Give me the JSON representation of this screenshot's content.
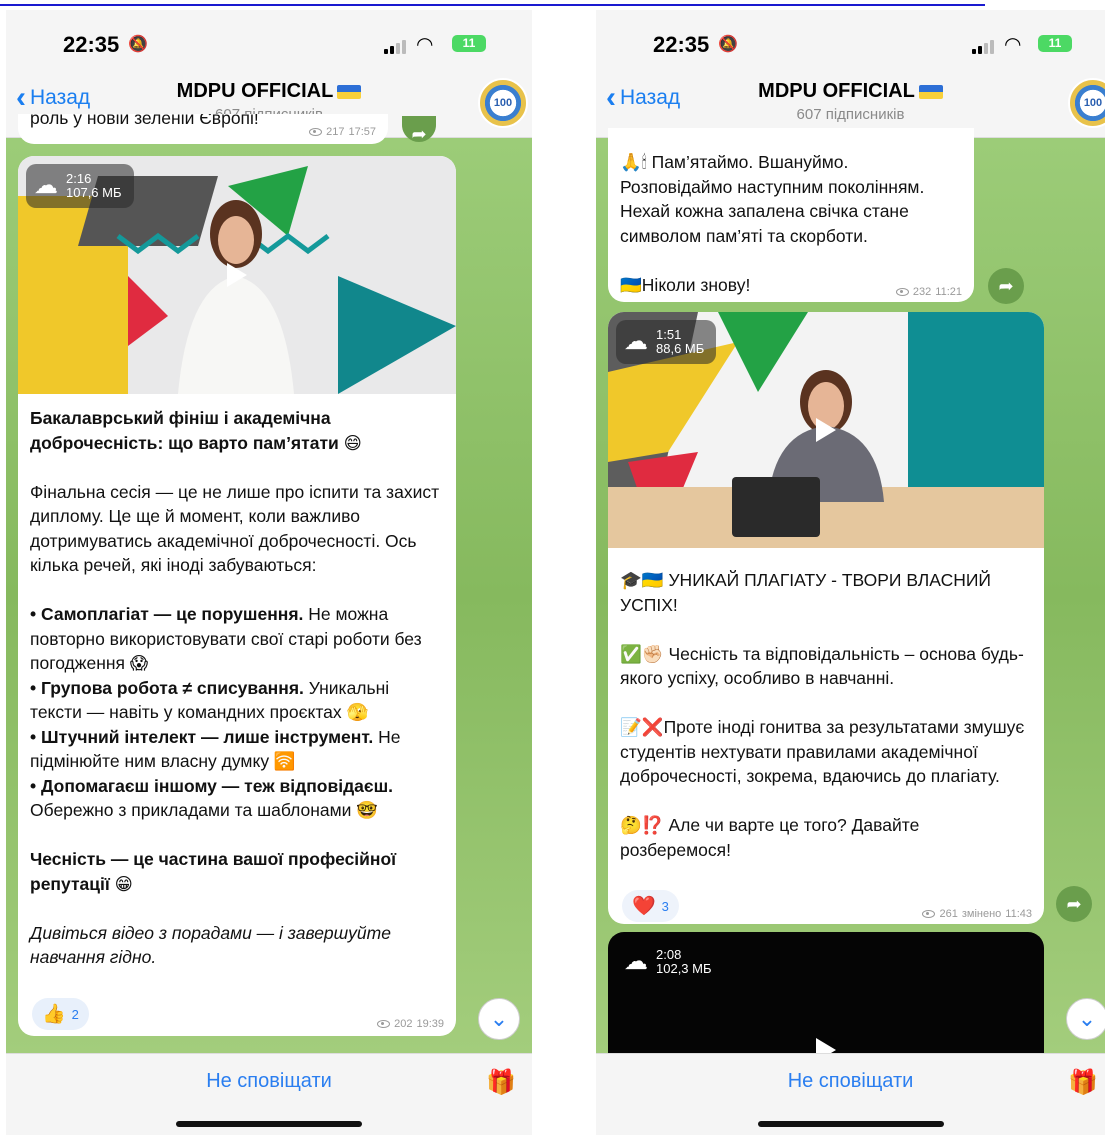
{
  "status": {
    "time": "22:35",
    "battery": "11"
  },
  "header": {
    "back_label": "Назад",
    "title": "MDPU OFFICIAL",
    "subscribers": "607 підписників",
    "avatar_text": "100"
  },
  "bottom": {
    "mute_label": "Не сповіщати"
  },
  "left": {
    "partial_text": "роль у новій зеленій Європі!",
    "partial_views": "217",
    "partial_time": "17:57",
    "video": {
      "duration": "2:16",
      "size": "107,6 МБ"
    },
    "post_title": "Бакалаврський фініш і академічна доброчесність: що варто пам’ятати 😄",
    "intro": "Фінальна сесія — це не лише про іспити та захист диплому. Це ще й момент, коли важливо дотримуватись академічної доброчесності. Ось кілька речей, які іноді забуваються:",
    "b1_bold": "• Самоплагіат — це порушення.",
    "b1_text": " Не можна повторно використовувати свої старі роботи без погодження 😱",
    "b2_bold": "• Групова робота ≠ списування.",
    "b2_text": " Уникальні тексти — навіть у командних проєктах 🫣",
    "b3_bold": "• Штучний інтелект — лише інструмент.",
    "b3_text": " Не підмінюйте ним власну думку 🛜",
    "b4_bold": "• Допомагаєш іншому — теж відповідаєш.",
    "b4_text": " Обережно з прикладами та шаблонами 🤓",
    "closing": "Чесність — це частина вашої професійної репутації 😁",
    "footer": "Дивіться відео з порадами — і завершуйте навчання гідно.",
    "reaction": {
      "emoji": "👍",
      "count": "2"
    },
    "views": "202",
    "time": "19:39"
  },
  "right": {
    "top_l1": "🙏🕯 Пам’ятаймо. Вшануймо.",
    "top_l2": "Розповідаймо наступним поколінням.",
    "top_l3": "Нехай кожна запалена свічка стане",
    "top_l4": "символом пам’яті та скорботи.",
    "top_never": "🇺🇦Ніколи знову!",
    "top_views": "232",
    "top_time": "11:21",
    "video": {
      "duration": "1:51",
      "size": "88,6 МБ"
    },
    "post_title": "🎓🇺🇦 УНИКАЙ ПЛАГІАТУ - ТВОРИ ВЛАСНИЙ УСПІХ!",
    "p1": "✅✊🏻 Чесність та відповідальність – основа будь-якого успіху, особливо в навчанні.",
    "p2": "📝❌Проте іноді гонитва за результатами змушує студентів нехтувати правилами академічної доброчесності, зокрема, вдаючись до плагіату.",
    "p3": "🤔⁉️ Але чи варте це того? Давайте розберемося!",
    "reaction": {
      "emoji": "❤️",
      "count": "3"
    },
    "views": "261",
    "edited": "змінено",
    "time": "11:43",
    "video2": {
      "duration": "2:08",
      "size": "102,3 МБ"
    }
  }
}
